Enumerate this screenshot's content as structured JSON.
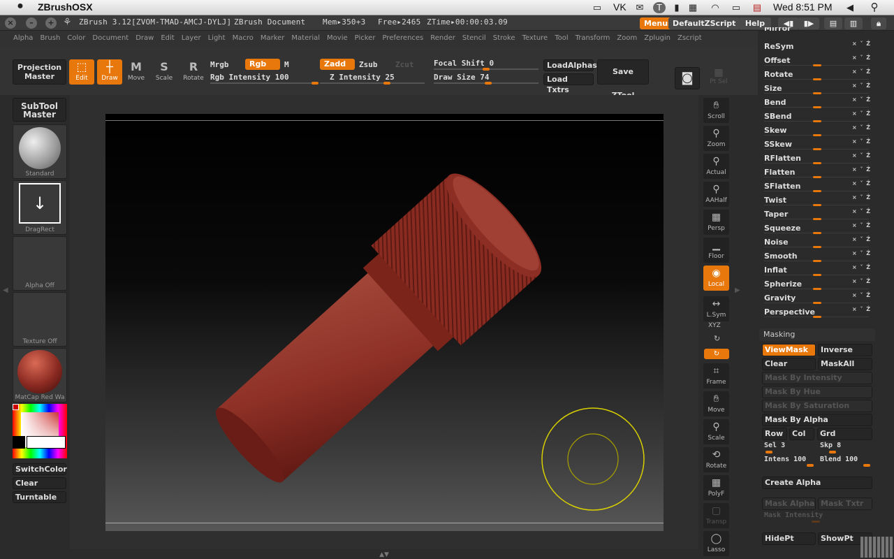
{
  "mac": {
    "app_name": "ZBrushOSX",
    "menubar_label": "VK",
    "clock": "Wed 8:51 PM"
  },
  "titlebar": {
    "version": "ZBrush 3.12[ZVOM-TMAD-AMCJ-DYLJ]",
    "document": "ZBrush Document",
    "mem": "Mem▸350+3",
    "free": "Free▸2465",
    "ztime": "ZTime▸00:00:03.09",
    "menus_label": "Menus",
    "script_label": "DefaultZScript",
    "help_label": "Help"
  },
  "menus": [
    "Alpha",
    "Brush",
    "Color",
    "Document",
    "Draw",
    "Edit",
    "Layer",
    "Light",
    "Macro",
    "Marker",
    "Material",
    "Movie",
    "Picker",
    "Preferences",
    "Render",
    "Stencil",
    "Stroke",
    "Texture",
    "Tool",
    "Transform",
    "Zoom",
    "Zplugin",
    "Zscript"
  ],
  "toolbar": {
    "projection_master": [
      "Projection",
      "Master"
    ],
    "edit": "Edit",
    "draw": "Draw",
    "move": "Move",
    "scale": "Scale",
    "rotate": "Rotate",
    "mrgb": "Mrgb",
    "rgb": "Rgb",
    "m": "M",
    "rgb_intensity": "Rgb Intensity 100",
    "zadd": "Zadd",
    "zsub": "Zsub",
    "zcut": "Zcut",
    "z_intensity": "Z Intensity 25",
    "focal_shift": "Focal Shift 0",
    "draw_size": "Draw Size 74",
    "load_alphas": "LoadAlphas",
    "load_txtrs": "Load Txtrs",
    "save_ztool": "Save ZTool",
    "ptsel": "Pt Sel",
    "rgb_intensity_value": 100,
    "z_intensity_value": 25,
    "focal_shift_value": 0,
    "draw_size_value": 74
  },
  "left": {
    "subtool_master": [
      "SubTool",
      "Master"
    ],
    "brush": "Standard",
    "stroke": "DragRect",
    "alpha": "Alpha Off",
    "texture": "Texture Off",
    "material": "MatCap Red Wa",
    "switch_color": "SwitchColor",
    "clear": "Clear",
    "turntable": "Turntable"
  },
  "shelf": [
    {
      "label": "Scroll",
      "icon": "hand-icon"
    },
    {
      "label": "Zoom",
      "icon": "magnifier-icon"
    },
    {
      "label": "Actual",
      "icon": "magnifier-icon"
    },
    {
      "label": "AAHalf",
      "icon": "magnifier-icon"
    },
    {
      "label": "Persp",
      "icon": "grid-icon"
    },
    {
      "label": "Floor",
      "icon": "floor-icon"
    },
    {
      "label": "Local",
      "icon": "local-icon"
    },
    {
      "label": "L.Sym",
      "icon": "sym-icon"
    },
    {
      "label": "Frame",
      "icon": "frame-icon"
    },
    {
      "label": "Move",
      "icon": "hand-icon"
    },
    {
      "label": "Scale",
      "icon": "magnifier-icon"
    },
    {
      "label": "Rotate",
      "icon": "rotate-icon"
    },
    {
      "label": "PolyF",
      "icon": "grid-icon"
    },
    {
      "label": "Transp",
      "icon": "transp-icon"
    },
    {
      "label": "Lasso",
      "icon": "lasso-icon"
    }
  ],
  "shelf_xyz": "XYZ",
  "deformation": [
    "Mirror",
    "ReSym",
    "Offset",
    "Rotate",
    "Size",
    "Bend",
    "SBend",
    "Skew",
    "SSkew",
    "RFlatten",
    "Flatten",
    "SFlatten",
    "Twist",
    "Taper",
    "Squeeze",
    "Noise",
    "Smooth",
    "Inflat",
    "Spherize",
    "Gravity",
    "Perspective"
  ],
  "masking": {
    "title": "Masking",
    "viewmask": "ViewMask",
    "inverse": "Inverse",
    "clear": "Clear",
    "maskall": "MaskAll",
    "by_intensity": "Mask By Intensity",
    "by_hue": "Mask By Hue",
    "by_saturation": "Mask By Saturation",
    "by_alpha": "Mask By Alpha",
    "row": "Row",
    "col": "Col",
    "grd": "Grd",
    "sel": "Sel 3",
    "skp": "Skp 8",
    "intens": "Intens 100",
    "blend": "Blend 100",
    "create_alpha": "Create Alpha",
    "mask_alpha": "Mask Alpha",
    "mask_txtr": "Mask Txtr",
    "mask_intensity": "Mask Intensity",
    "hidept": "HidePt",
    "showpt": "ShowPt"
  },
  "colors": {
    "accent": "#e8780c",
    "model": "#8b2a22",
    "cursor_ring": "#d8d000"
  }
}
